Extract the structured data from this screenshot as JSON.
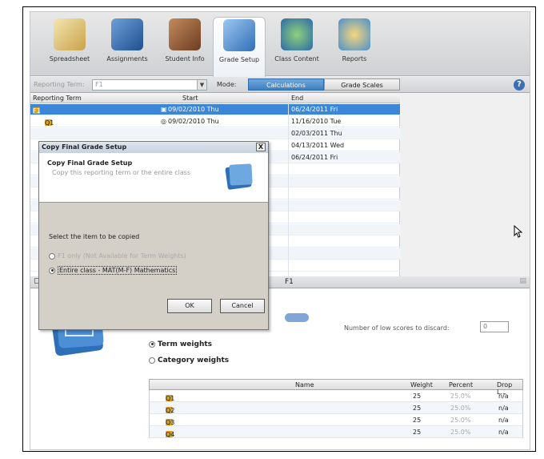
{
  "toolbar": {
    "items": [
      {
        "label": "Spreadsheet",
        "icon": "spreadsheet-icon"
      },
      {
        "label": "Assignments",
        "icon": "assignments-icon"
      },
      {
        "label": "Student Info",
        "icon": "student-info-icon"
      },
      {
        "label": "Grade Setup",
        "icon": "grade-setup-icon"
      },
      {
        "label": "Class Content",
        "icon": "class-content-icon"
      },
      {
        "label": "Reports",
        "icon": "reports-icon"
      }
    ]
  },
  "subbar": {
    "reporting_term_label": "Reporting Term:",
    "reporting_term_value": "F1",
    "mode_label": "Mode:",
    "calculations": "Calculations",
    "grade_scales": "Grade Scales",
    "help": "?"
  },
  "grid": {
    "headers": [
      "Reporting Term",
      "Start",
      "End"
    ],
    "rows": [
      {
        "term": "F1",
        "start": "09/02/2010 Thu",
        "end": "06/24/2011 Fri",
        "selected": true
      },
      {
        "term": "Q1",
        "start": "09/02/2010 Thu",
        "end": "11/16/2010 Tue"
      },
      {
        "term": "",
        "start": "",
        "end": "02/03/2011 Thu"
      },
      {
        "term": "",
        "start": "",
        "end": "04/13/2011 Wed"
      },
      {
        "term": "",
        "start": "",
        "end": "06/24/2011 Fri"
      }
    ]
  },
  "lower": {
    "title": "F1",
    "number_low_label": "Number of low scores to discard:",
    "number_low_value": "0",
    "term_weights": "Term weights",
    "category_weights": "Category weights",
    "table_headers": [
      "Name",
      "Weight",
      "Percent",
      "Drop L..."
    ],
    "rows": [
      {
        "name": "Q1",
        "weight": "25",
        "percent": "25.0%",
        "drop": "n/a"
      },
      {
        "name": "Q2",
        "weight": "25",
        "percent": "25.0%",
        "drop": "n/a"
      },
      {
        "name": "Q3",
        "weight": "25",
        "percent": "25.0%",
        "drop": "n/a"
      },
      {
        "name": "Q4",
        "weight": "25",
        "percent": "25.0%",
        "drop": "n/a"
      }
    ]
  },
  "dialog": {
    "title": "Copy Final Grade Setup",
    "close": "X",
    "heading": "Copy Final Grade Setup",
    "subtitle": "Copy this reporting term or the entire class",
    "select_label": "Select the item to be copied",
    "option1": "F1 only (Not Available for Term Weights)",
    "option2": "Entire class - MAT(M-F) Mathematics",
    "ok": "OK",
    "cancel": "Cancel"
  }
}
